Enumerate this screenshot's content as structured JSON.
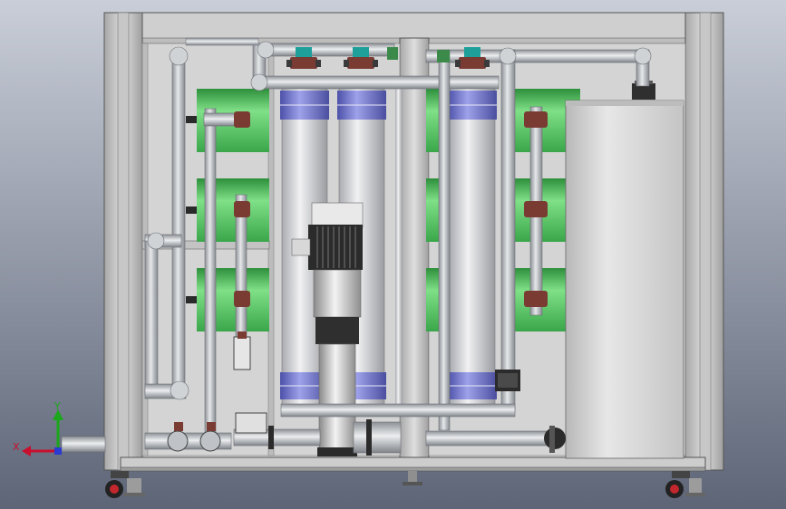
{
  "viewport": {
    "background_top": "#c9ced8",
    "background_bottom": "#5d6577"
  },
  "triad": {
    "x_label": "X",
    "y_label": "Y",
    "x_color": "#c8102e",
    "y_color": "#1ba61b",
    "z_color": "#2a3bd1"
  },
  "colors": {
    "frame": "#c9c9c9",
    "pipe": "#bfc3c7",
    "membrane_green": "#5fd16a",
    "housing": "#d8d8d8",
    "band": "#6e72c9",
    "valve": "#7a3b33",
    "valve_teal": "#1e9f9a",
    "tank": "#d3d3d3",
    "motor": "#2b2b2b"
  }
}
